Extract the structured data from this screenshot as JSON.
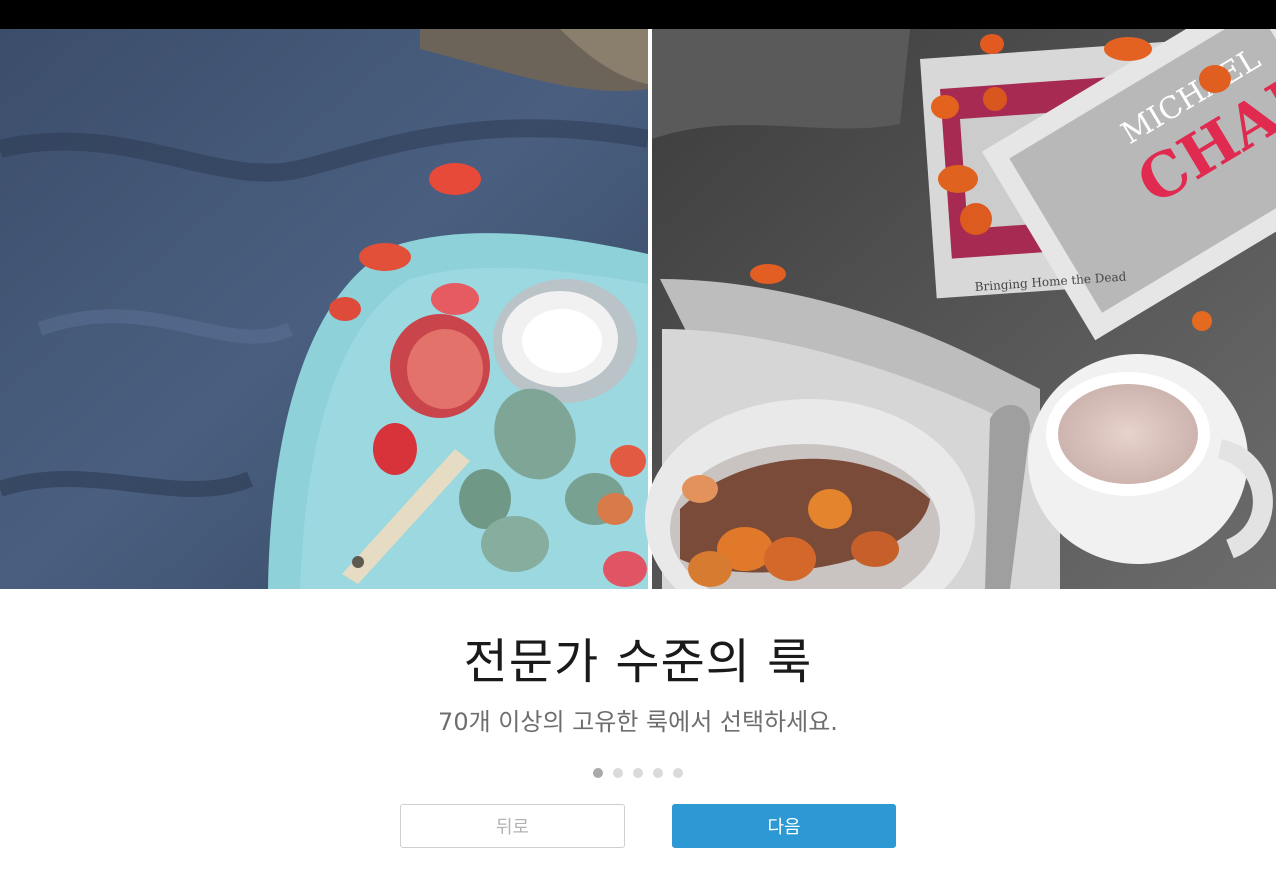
{
  "onboarding": {
    "title": "전문가 수준의 룩",
    "subtitle": "70개 이상의 고유한 룩에서 선택하세요.",
    "page_indicator": {
      "total": 5,
      "current": 1
    },
    "back_label": "뒤로",
    "next_label": "다음"
  },
  "hero": {
    "left_tone": "color",
    "right_tone": "selective-color",
    "book_text_1": "MICHAEL",
    "book_text_2": "CHAB",
    "book_spine_text": "Bringing Home the Dead"
  },
  "colors": {
    "accent": "#2c99d4",
    "topbar": "#000000",
    "dot_active": "#a9a9a9",
    "dot_inactive": "#dadada"
  }
}
